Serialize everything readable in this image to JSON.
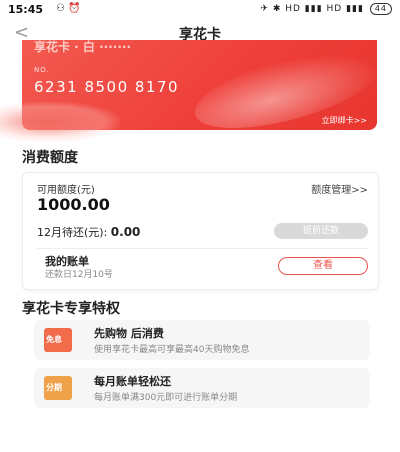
{
  "status_bar": {
    "time": "15:45",
    "left_icons": "⚇ ⏰",
    "right_icons": "✈ ✱ HD ▮▮▮ HD ▮▮▮",
    "battery": "44"
  },
  "nav": {
    "back": "<",
    "title": "享花卡"
  },
  "card": {
    "brand": "享花卡 · 白 ·······",
    "number_label": "NO.",
    "number": "6231 8500 8170",
    "bind_link": "立即绑卡>>"
  },
  "quota_section": {
    "title": "消费额度",
    "available_label": "可用额度(元)",
    "management_link": "额度管理>>",
    "amount": "1000.00",
    "due_label": "12月待还(元):",
    "due_value": "0.00",
    "repay_button": "提前还款",
    "bill_title": "我的账单",
    "bill_due": "还款日12月10号",
    "view_button": "查看"
  },
  "perks": {
    "title": "享花卡专享特权",
    "items": [
      {
        "badge": "免息",
        "title": "先购物 后消费",
        "subtitle": "使用享花卡最高可享最高40天购物免息",
        "color": "#f26b4a"
      },
      {
        "badge": "分期",
        "title": "每月账单轻松还",
        "subtitle": "每月账单满300元即可进行账单分期",
        "color": "#f0a24a"
      }
    ]
  }
}
